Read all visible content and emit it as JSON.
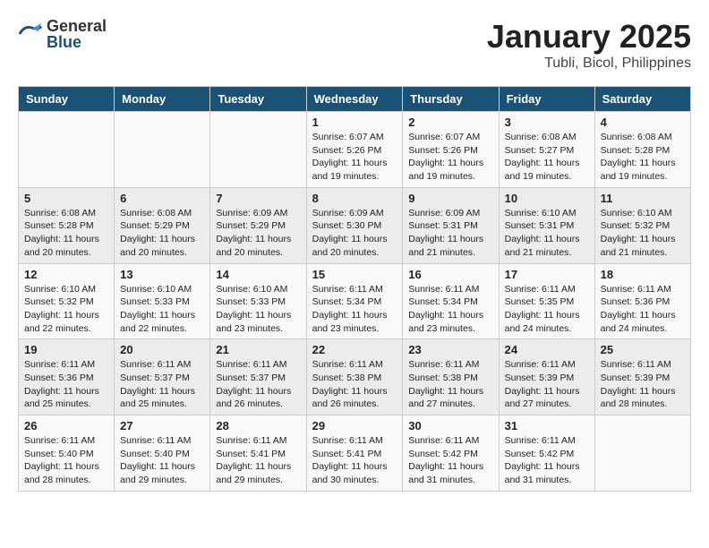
{
  "header": {
    "logo_general": "General",
    "logo_blue": "Blue",
    "title": "January 2025",
    "subtitle": "Tubli, Bicol, Philippines"
  },
  "weekdays": [
    "Sunday",
    "Monday",
    "Tuesday",
    "Wednesday",
    "Thursday",
    "Friday",
    "Saturday"
  ],
  "rows": [
    [
      {
        "day": "",
        "info": ""
      },
      {
        "day": "",
        "info": ""
      },
      {
        "day": "",
        "info": ""
      },
      {
        "day": "1",
        "info": "Sunrise: 6:07 AM\nSunset: 5:26 PM\nDaylight: 11 hours and 19 minutes."
      },
      {
        "day": "2",
        "info": "Sunrise: 6:07 AM\nSunset: 5:26 PM\nDaylight: 11 hours and 19 minutes."
      },
      {
        "day": "3",
        "info": "Sunrise: 6:08 AM\nSunset: 5:27 PM\nDaylight: 11 hours and 19 minutes."
      },
      {
        "day": "4",
        "info": "Sunrise: 6:08 AM\nSunset: 5:28 PM\nDaylight: 11 hours and 19 minutes."
      }
    ],
    [
      {
        "day": "5",
        "info": "Sunrise: 6:08 AM\nSunset: 5:28 PM\nDaylight: 11 hours and 20 minutes."
      },
      {
        "day": "6",
        "info": "Sunrise: 6:08 AM\nSunset: 5:29 PM\nDaylight: 11 hours and 20 minutes."
      },
      {
        "day": "7",
        "info": "Sunrise: 6:09 AM\nSunset: 5:29 PM\nDaylight: 11 hours and 20 minutes."
      },
      {
        "day": "8",
        "info": "Sunrise: 6:09 AM\nSunset: 5:30 PM\nDaylight: 11 hours and 20 minutes."
      },
      {
        "day": "9",
        "info": "Sunrise: 6:09 AM\nSunset: 5:31 PM\nDaylight: 11 hours and 21 minutes."
      },
      {
        "day": "10",
        "info": "Sunrise: 6:10 AM\nSunset: 5:31 PM\nDaylight: 11 hours and 21 minutes."
      },
      {
        "day": "11",
        "info": "Sunrise: 6:10 AM\nSunset: 5:32 PM\nDaylight: 11 hours and 21 minutes."
      }
    ],
    [
      {
        "day": "12",
        "info": "Sunrise: 6:10 AM\nSunset: 5:32 PM\nDaylight: 11 hours and 22 minutes."
      },
      {
        "day": "13",
        "info": "Sunrise: 6:10 AM\nSunset: 5:33 PM\nDaylight: 11 hours and 22 minutes."
      },
      {
        "day": "14",
        "info": "Sunrise: 6:10 AM\nSunset: 5:33 PM\nDaylight: 11 hours and 23 minutes."
      },
      {
        "day": "15",
        "info": "Sunrise: 6:11 AM\nSunset: 5:34 PM\nDaylight: 11 hours and 23 minutes."
      },
      {
        "day": "16",
        "info": "Sunrise: 6:11 AM\nSunset: 5:34 PM\nDaylight: 11 hours and 23 minutes."
      },
      {
        "day": "17",
        "info": "Sunrise: 6:11 AM\nSunset: 5:35 PM\nDaylight: 11 hours and 24 minutes."
      },
      {
        "day": "18",
        "info": "Sunrise: 6:11 AM\nSunset: 5:36 PM\nDaylight: 11 hours and 24 minutes."
      }
    ],
    [
      {
        "day": "19",
        "info": "Sunrise: 6:11 AM\nSunset: 5:36 PM\nDaylight: 11 hours and 25 minutes."
      },
      {
        "day": "20",
        "info": "Sunrise: 6:11 AM\nSunset: 5:37 PM\nDaylight: 11 hours and 25 minutes."
      },
      {
        "day": "21",
        "info": "Sunrise: 6:11 AM\nSunset: 5:37 PM\nDaylight: 11 hours and 26 minutes."
      },
      {
        "day": "22",
        "info": "Sunrise: 6:11 AM\nSunset: 5:38 PM\nDaylight: 11 hours and 26 minutes."
      },
      {
        "day": "23",
        "info": "Sunrise: 6:11 AM\nSunset: 5:38 PM\nDaylight: 11 hours and 27 minutes."
      },
      {
        "day": "24",
        "info": "Sunrise: 6:11 AM\nSunset: 5:39 PM\nDaylight: 11 hours and 27 minutes."
      },
      {
        "day": "25",
        "info": "Sunrise: 6:11 AM\nSunset: 5:39 PM\nDaylight: 11 hours and 28 minutes."
      }
    ],
    [
      {
        "day": "26",
        "info": "Sunrise: 6:11 AM\nSunset: 5:40 PM\nDaylight: 11 hours and 28 minutes."
      },
      {
        "day": "27",
        "info": "Sunrise: 6:11 AM\nSunset: 5:40 PM\nDaylight: 11 hours and 29 minutes."
      },
      {
        "day": "28",
        "info": "Sunrise: 6:11 AM\nSunset: 5:41 PM\nDaylight: 11 hours and 29 minutes."
      },
      {
        "day": "29",
        "info": "Sunrise: 6:11 AM\nSunset: 5:41 PM\nDaylight: 11 hours and 30 minutes."
      },
      {
        "day": "30",
        "info": "Sunrise: 6:11 AM\nSunset: 5:42 PM\nDaylight: 11 hours and 31 minutes."
      },
      {
        "day": "31",
        "info": "Sunrise: 6:11 AM\nSunset: 5:42 PM\nDaylight: 11 hours and 31 minutes."
      },
      {
        "day": "",
        "info": ""
      }
    ]
  ]
}
